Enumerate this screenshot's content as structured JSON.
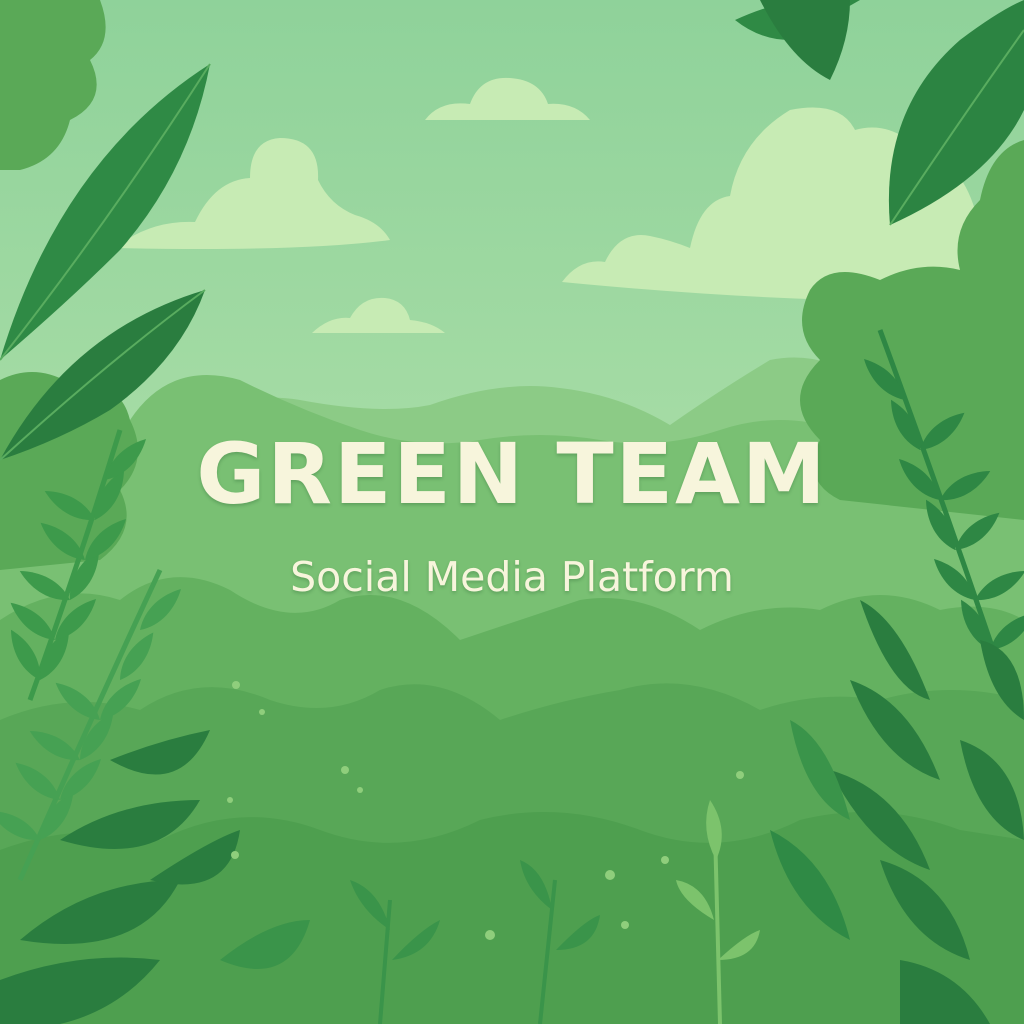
{
  "banner": {
    "title": "GREEN TEAM",
    "subtitle": "Social Media Platform"
  },
  "colors": {
    "sky": "#a3dba1",
    "text": "#f7f5dc",
    "leaf_dark": "#2b7d40",
    "leaf_mid": "#3f9a4d",
    "foliage": "#5fae5e"
  },
  "scene": {
    "elements": [
      "clouds",
      "mountains",
      "forest canopy",
      "fern fronds",
      "large leaves",
      "small flowers"
    ]
  }
}
